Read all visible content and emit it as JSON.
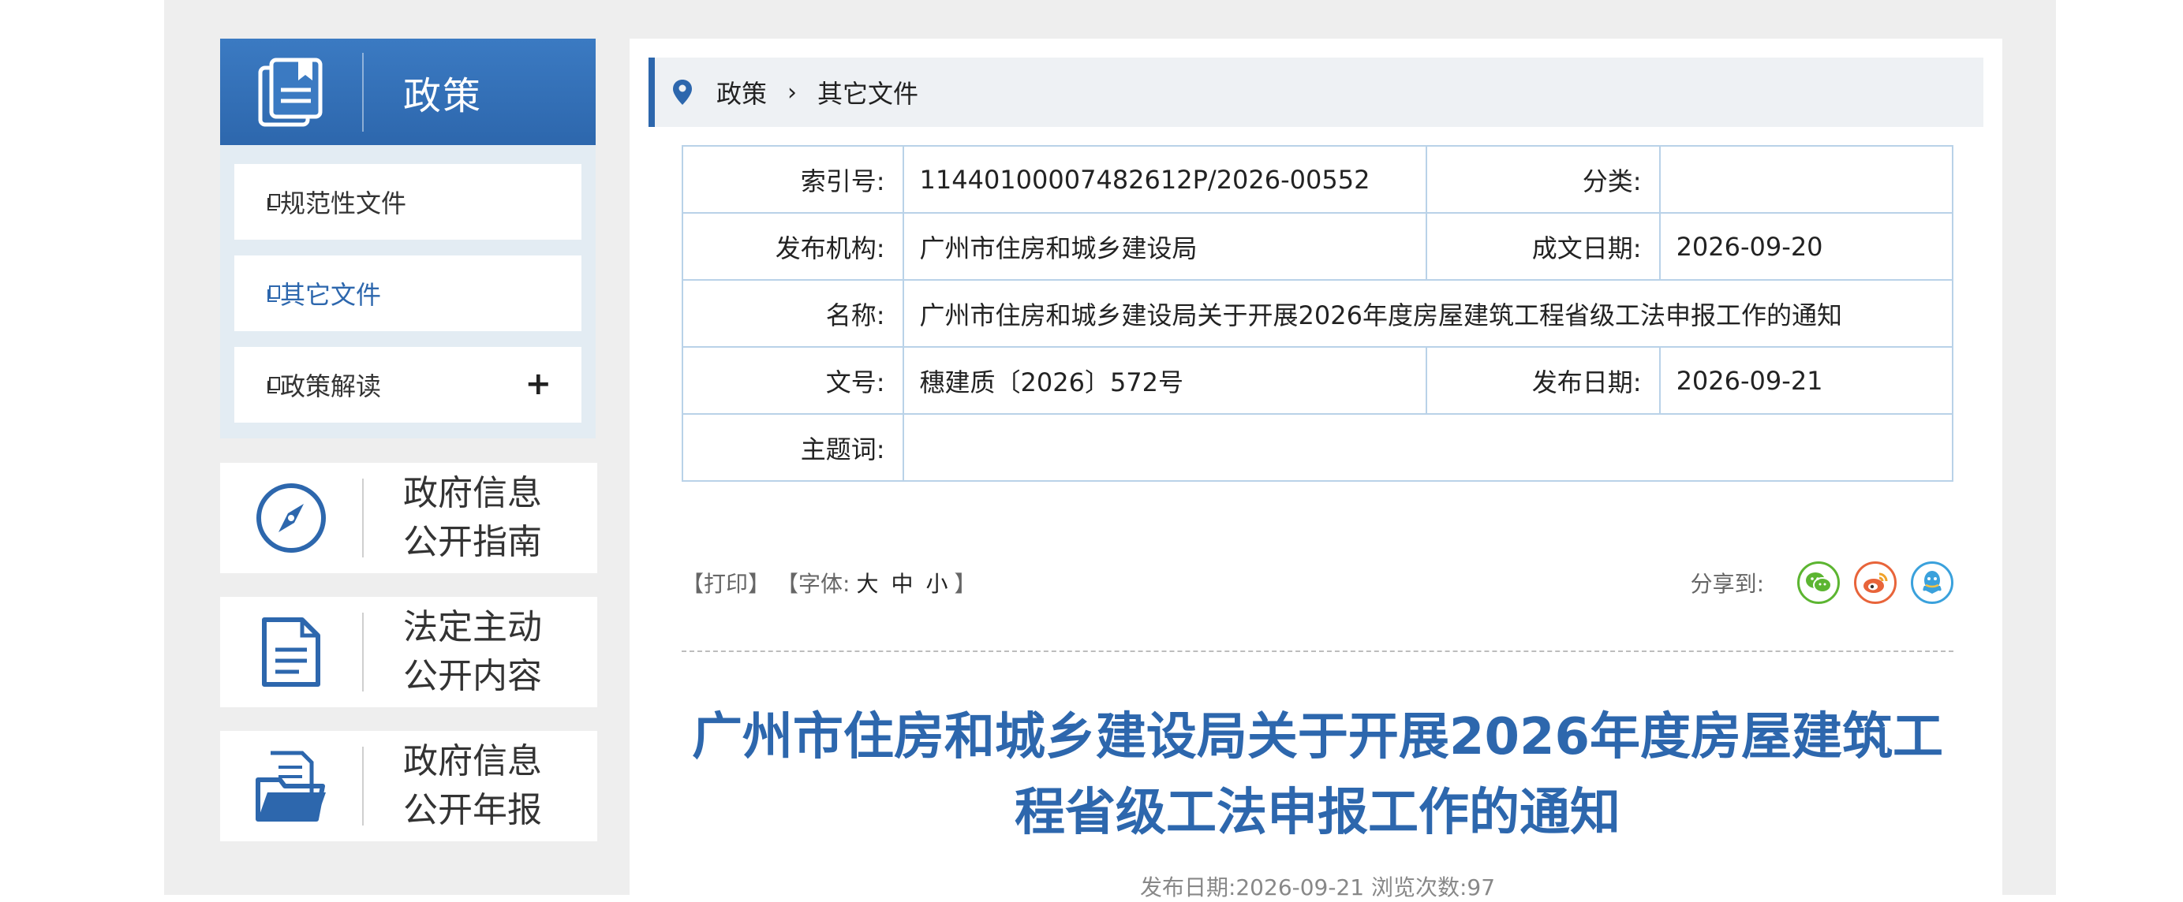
{
  "sidebar": {
    "header_title": "政策",
    "items": [
      {
        "label": "规范性文件"
      },
      {
        "label": "其它文件"
      },
      {
        "label": "政策解读",
        "expand": "+"
      }
    ],
    "cards": [
      {
        "line1": "政府信息",
        "line2": "公开指南",
        "icon": "compass-icon"
      },
      {
        "line1": "法定主动",
        "line2": "公开内容",
        "icon": "document-icon"
      },
      {
        "line1": "政府信息",
        "line2": "公开年报",
        "icon": "folder-icon"
      }
    ]
  },
  "breadcrumb": {
    "root": "政策",
    "separator": "›",
    "current": "其它文件"
  },
  "meta": {
    "index_label": "索引号:",
    "index_value": "11440100007482612P/2026-00552",
    "category_label": "分类:",
    "category_value": "",
    "publisher_label": "发布机构:",
    "publisher_value": "广州市住房和城乡建设局",
    "written_date_label": "成文日期:",
    "written_date_value": "2026-09-20",
    "name_label": "名称:",
    "name_value": "广州市住房和城乡建设局关于开展2026年度房屋建筑工程省级工法申报工作的通知",
    "doc_no_label": "文号:",
    "doc_no_value": "穗建质〔2026〕572号",
    "pub_date_label": "发布日期:",
    "pub_date_value": "2026-09-21",
    "keywords_label": "主题词:",
    "keywords_value": ""
  },
  "tools": {
    "print": "【打印】",
    "font_prefix": "【字体:",
    "font_large": "大",
    "font_medium": "中",
    "font_small": "小",
    "font_suffix": "】",
    "share_label": "分享到:"
  },
  "article": {
    "title_line1": "广州市住房和城乡建设局关于开展2026年度房屋建筑工",
    "title_line2": "程省级工法申报工作的通知",
    "pub_info": "发布日期:2026-09-21  浏览次数:97"
  },
  "colors": {
    "brand_blue": "#2d67ad",
    "wechat": "#5cb531",
    "weibo": "#e8643a",
    "qq": "#3aa1dc"
  }
}
